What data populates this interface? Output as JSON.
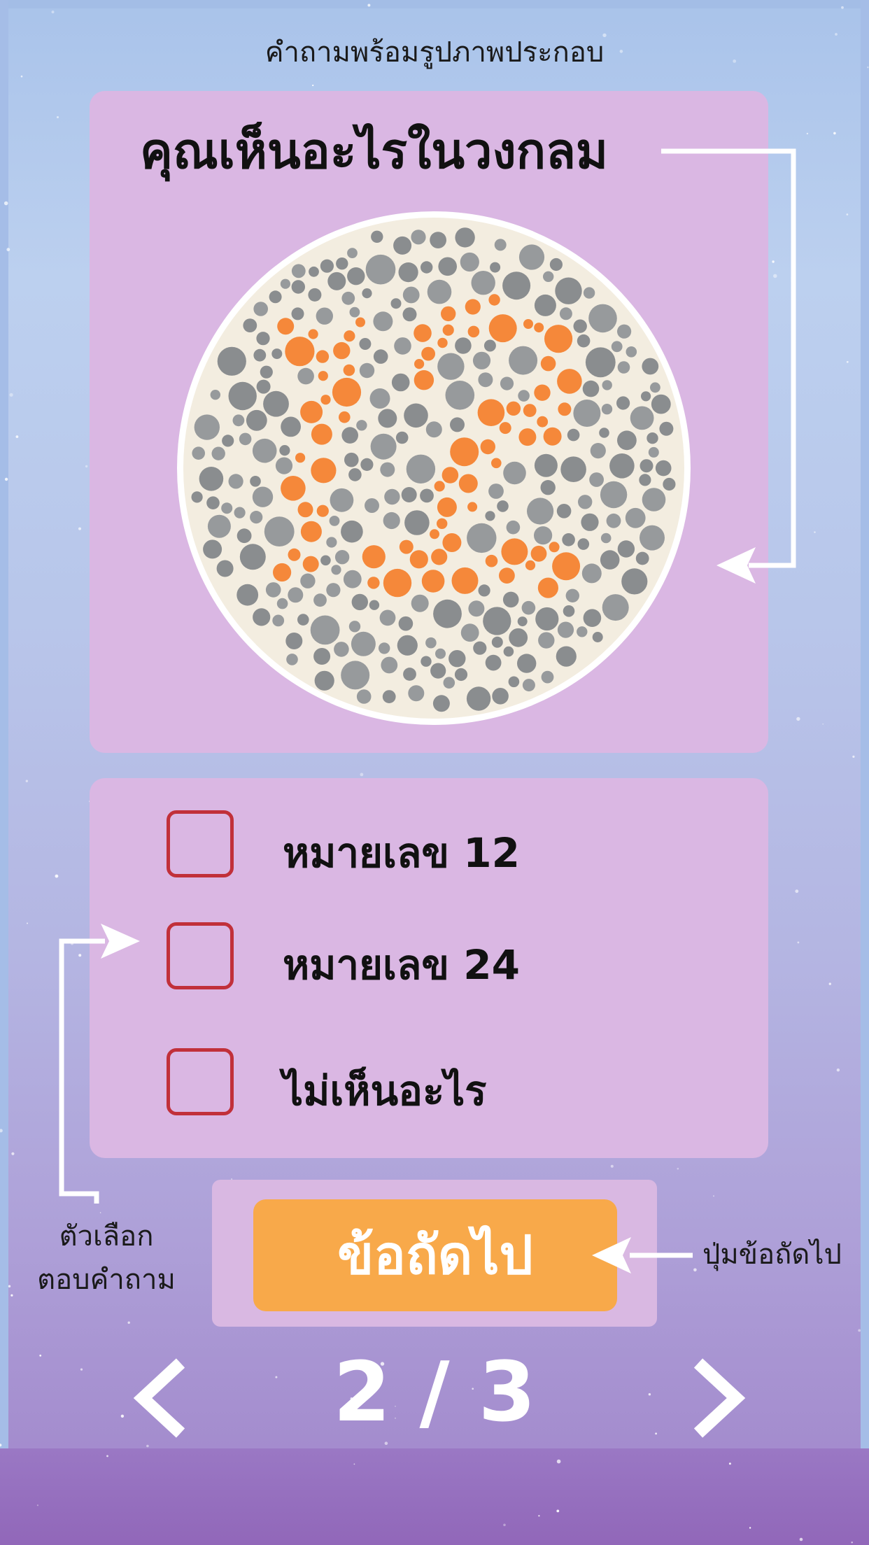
{
  "header": {
    "caption": "คำถามพร้อมรูปภาพประกอบ"
  },
  "question": {
    "title": "คุณเห็นอะไรในวงกลม",
    "image": "ishihara-color-plate"
  },
  "options": [
    {
      "label": "หมายเลข 12",
      "checked": false
    },
    {
      "label": "หมายเลข 24",
      "checked": false
    },
    {
      "label": "ไม่เห็นอะไร",
      "checked": false
    }
  ],
  "annotations": {
    "options_caption_line1": "ตัวเลือก",
    "options_caption_line2": "ตอบคำถาม",
    "next_caption": "ปุ่มข้อถัดไป"
  },
  "next_button": {
    "label": "ข้อถัดไป"
  },
  "pagination": {
    "indicator": "2 / 3",
    "prev_icon": "chevron-left-icon",
    "next_icon": "chevron-right-icon"
  },
  "colors": {
    "card": "#dab7e3",
    "checkbox_border": "#c1303a",
    "next_button": "#f8a94a",
    "dot_gray": "#8a8d8f",
    "dot_orange": "#f5883a"
  }
}
